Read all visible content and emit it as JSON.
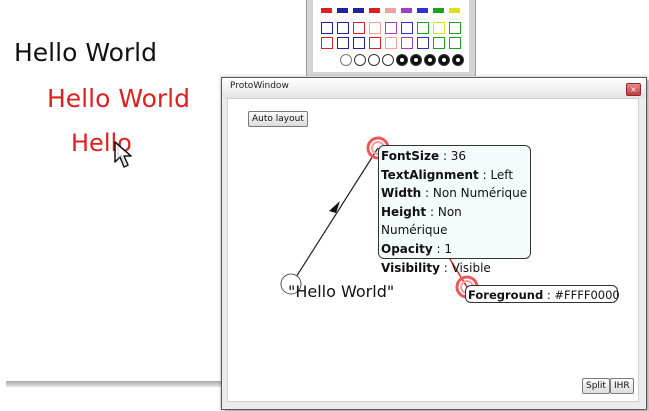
{
  "canvas": {
    "text1": "Hello World",
    "text2": "Hello World",
    "text3": "Hello",
    "colors": {
      "text1": "#111111",
      "text2": "#e02020",
      "text3": "#e02020"
    }
  },
  "palette": {
    "top_colors": [
      "#e02020",
      "#2020a0",
      "#2020a0",
      "#e02020",
      "#f0a0a0",
      "#a040c0",
      "#3030d0",
      "#20a020",
      "#e0e020"
    ]
  },
  "window": {
    "title": "ProtoWindow",
    "close_glyph": "×",
    "auto_layout": "Auto layout",
    "split": "Split",
    "ihr": "IHR"
  },
  "node": {
    "hello": "\"Hello World\"",
    "props": [
      {
        "name": "FontSize",
        "value": " : 36"
      },
      {
        "name": "TextAlignment",
        "value": " : Left"
      },
      {
        "name": "Width",
        "value": " : Non Numérique"
      },
      {
        "name": "Height",
        "value": " : Non Numérique"
      },
      {
        "name": "Opacity",
        "value": " : 1"
      },
      {
        "name": "Visibility",
        "value": " : Visible"
      }
    ],
    "foreground_name": "Foreground",
    "foreground_value": " : #FFFF0000"
  },
  "accent": "#e02020"
}
